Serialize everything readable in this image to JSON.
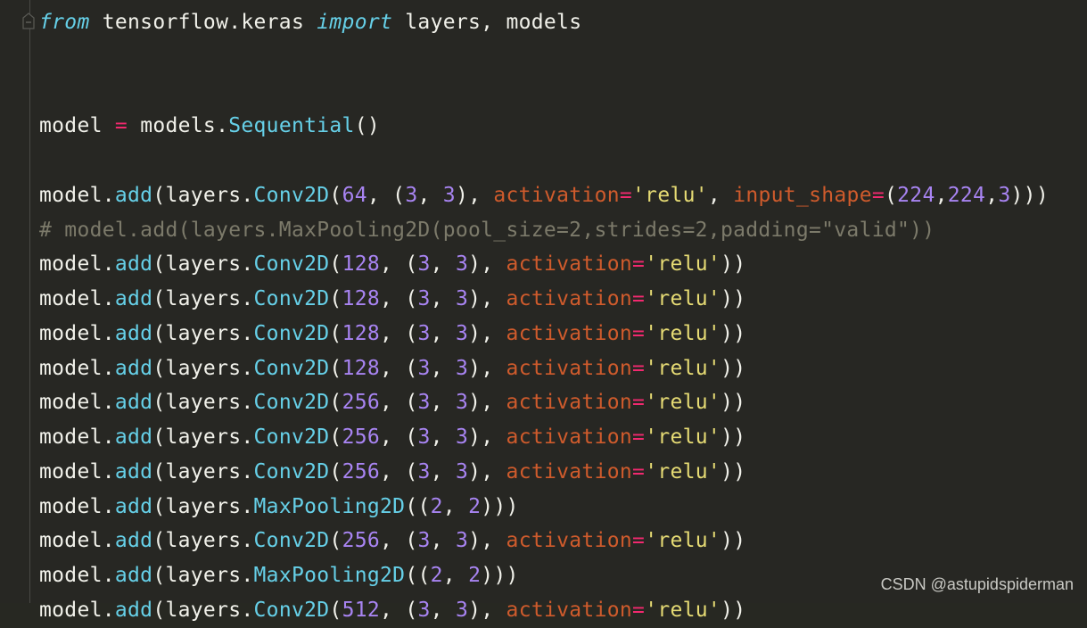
{
  "editor": {
    "lines": [
      [
        {
          "t": "kw",
          "v": "from"
        },
        {
          "t": "txt",
          "v": " tensorflow.keras "
        },
        {
          "t": "kw",
          "v": "import"
        },
        {
          "t": "txt",
          "v": " layers, models"
        }
      ],
      [],
      [],
      [
        {
          "t": "txt",
          "v": "model "
        },
        {
          "t": "op",
          "v": "="
        },
        {
          "t": "txt",
          "v": " models."
        },
        {
          "t": "fn",
          "v": "Sequential"
        },
        {
          "t": "txt",
          "v": "()"
        }
      ],
      [],
      [
        {
          "t": "txt",
          "v": "model."
        },
        {
          "t": "fn",
          "v": "add"
        },
        {
          "t": "txt",
          "v": "(layers."
        },
        {
          "t": "fn",
          "v": "Conv2D"
        },
        {
          "t": "txt",
          "v": "("
        },
        {
          "t": "num",
          "v": "64"
        },
        {
          "t": "txt",
          "v": ", ("
        },
        {
          "t": "num",
          "v": "3"
        },
        {
          "t": "txt",
          "v": ", "
        },
        {
          "t": "num",
          "v": "3"
        },
        {
          "t": "txt",
          "v": "), "
        },
        {
          "t": "param",
          "v": "activation"
        },
        {
          "t": "op",
          "v": "="
        },
        {
          "t": "str",
          "v": "'relu'"
        },
        {
          "t": "txt",
          "v": ", "
        },
        {
          "t": "param",
          "v": "input_shape"
        },
        {
          "t": "op",
          "v": "="
        },
        {
          "t": "txt",
          "v": "("
        },
        {
          "t": "num",
          "v": "224"
        },
        {
          "t": "txt",
          "v": ","
        },
        {
          "t": "num",
          "v": "224"
        },
        {
          "t": "txt",
          "v": ","
        },
        {
          "t": "num",
          "v": "3"
        },
        {
          "t": "txt",
          "v": ")))"
        }
      ],
      [
        {
          "t": "cm",
          "v": "# model.add(layers.MaxPooling2D(pool_size=2,strides=2,padding=\"valid\"))"
        }
      ],
      [
        {
          "t": "txt",
          "v": "model."
        },
        {
          "t": "fn",
          "v": "add"
        },
        {
          "t": "txt",
          "v": "(layers."
        },
        {
          "t": "fn",
          "v": "Conv2D"
        },
        {
          "t": "txt",
          "v": "("
        },
        {
          "t": "num",
          "v": "128"
        },
        {
          "t": "txt",
          "v": ", ("
        },
        {
          "t": "num",
          "v": "3"
        },
        {
          "t": "txt",
          "v": ", "
        },
        {
          "t": "num",
          "v": "3"
        },
        {
          "t": "txt",
          "v": "), "
        },
        {
          "t": "param",
          "v": "activation"
        },
        {
          "t": "op",
          "v": "="
        },
        {
          "t": "str",
          "v": "'relu'"
        },
        {
          "t": "txt",
          "v": "))"
        }
      ],
      [
        {
          "t": "txt",
          "v": "model."
        },
        {
          "t": "fn",
          "v": "add"
        },
        {
          "t": "txt",
          "v": "(layers."
        },
        {
          "t": "fn",
          "v": "Conv2D"
        },
        {
          "t": "txt",
          "v": "("
        },
        {
          "t": "num",
          "v": "128"
        },
        {
          "t": "txt",
          "v": ", ("
        },
        {
          "t": "num",
          "v": "3"
        },
        {
          "t": "txt",
          "v": ", "
        },
        {
          "t": "num",
          "v": "3"
        },
        {
          "t": "txt",
          "v": "), "
        },
        {
          "t": "param",
          "v": "activation"
        },
        {
          "t": "op",
          "v": "="
        },
        {
          "t": "str",
          "v": "'relu'"
        },
        {
          "t": "txt",
          "v": "))"
        }
      ],
      [
        {
          "t": "txt",
          "v": "model."
        },
        {
          "t": "fn",
          "v": "add"
        },
        {
          "t": "txt",
          "v": "(layers."
        },
        {
          "t": "fn",
          "v": "Conv2D"
        },
        {
          "t": "txt",
          "v": "("
        },
        {
          "t": "num",
          "v": "128"
        },
        {
          "t": "txt",
          "v": ", ("
        },
        {
          "t": "num",
          "v": "3"
        },
        {
          "t": "txt",
          "v": ", "
        },
        {
          "t": "num",
          "v": "3"
        },
        {
          "t": "txt",
          "v": "), "
        },
        {
          "t": "param",
          "v": "activation"
        },
        {
          "t": "op",
          "v": "="
        },
        {
          "t": "str",
          "v": "'relu'"
        },
        {
          "t": "txt",
          "v": "))"
        }
      ],
      [
        {
          "t": "txt",
          "v": "model."
        },
        {
          "t": "fn",
          "v": "add"
        },
        {
          "t": "txt",
          "v": "(layers."
        },
        {
          "t": "fn",
          "v": "Conv2D"
        },
        {
          "t": "txt",
          "v": "("
        },
        {
          "t": "num",
          "v": "128"
        },
        {
          "t": "txt",
          "v": ", ("
        },
        {
          "t": "num",
          "v": "3"
        },
        {
          "t": "txt",
          "v": ", "
        },
        {
          "t": "num",
          "v": "3"
        },
        {
          "t": "txt",
          "v": "), "
        },
        {
          "t": "param",
          "v": "activation"
        },
        {
          "t": "op",
          "v": "="
        },
        {
          "t": "str",
          "v": "'relu'"
        },
        {
          "t": "txt",
          "v": "))"
        }
      ],
      [
        {
          "t": "txt",
          "v": "model."
        },
        {
          "t": "fn",
          "v": "add"
        },
        {
          "t": "txt",
          "v": "(layers."
        },
        {
          "t": "fn",
          "v": "Conv2D"
        },
        {
          "t": "txt",
          "v": "("
        },
        {
          "t": "num",
          "v": "256"
        },
        {
          "t": "txt",
          "v": ", ("
        },
        {
          "t": "num",
          "v": "3"
        },
        {
          "t": "txt",
          "v": ", "
        },
        {
          "t": "num",
          "v": "3"
        },
        {
          "t": "txt",
          "v": "), "
        },
        {
          "t": "param",
          "v": "activation"
        },
        {
          "t": "op",
          "v": "="
        },
        {
          "t": "str",
          "v": "'relu'"
        },
        {
          "t": "txt",
          "v": "))"
        }
      ],
      [
        {
          "t": "txt",
          "v": "model."
        },
        {
          "t": "fn",
          "v": "add"
        },
        {
          "t": "txt",
          "v": "(layers."
        },
        {
          "t": "fn",
          "v": "Conv2D"
        },
        {
          "t": "txt",
          "v": "("
        },
        {
          "t": "num",
          "v": "256"
        },
        {
          "t": "txt",
          "v": ", ("
        },
        {
          "t": "num",
          "v": "3"
        },
        {
          "t": "txt",
          "v": ", "
        },
        {
          "t": "num",
          "v": "3"
        },
        {
          "t": "txt",
          "v": "), "
        },
        {
          "t": "param",
          "v": "activation"
        },
        {
          "t": "op",
          "v": "="
        },
        {
          "t": "str",
          "v": "'relu'"
        },
        {
          "t": "txt",
          "v": "))"
        }
      ],
      [
        {
          "t": "txt",
          "v": "model."
        },
        {
          "t": "fn",
          "v": "add"
        },
        {
          "t": "txt",
          "v": "(layers."
        },
        {
          "t": "fn",
          "v": "Conv2D"
        },
        {
          "t": "txt",
          "v": "("
        },
        {
          "t": "num",
          "v": "256"
        },
        {
          "t": "txt",
          "v": ", ("
        },
        {
          "t": "num",
          "v": "3"
        },
        {
          "t": "txt",
          "v": ", "
        },
        {
          "t": "num",
          "v": "3"
        },
        {
          "t": "txt",
          "v": "), "
        },
        {
          "t": "param",
          "v": "activation"
        },
        {
          "t": "op",
          "v": "="
        },
        {
          "t": "str",
          "v": "'relu'"
        },
        {
          "t": "txt",
          "v": "))"
        }
      ],
      [
        {
          "t": "txt",
          "v": "model."
        },
        {
          "t": "fn",
          "v": "add"
        },
        {
          "t": "txt",
          "v": "(layers."
        },
        {
          "t": "fn",
          "v": "MaxPooling2D"
        },
        {
          "t": "txt",
          "v": "(("
        },
        {
          "t": "num",
          "v": "2"
        },
        {
          "t": "txt",
          "v": ", "
        },
        {
          "t": "num",
          "v": "2"
        },
        {
          "t": "txt",
          "v": ")))"
        }
      ],
      [
        {
          "t": "txt",
          "v": "model."
        },
        {
          "t": "fn",
          "v": "add"
        },
        {
          "t": "txt",
          "v": "(layers."
        },
        {
          "t": "fn",
          "v": "Conv2D"
        },
        {
          "t": "txt",
          "v": "("
        },
        {
          "t": "num",
          "v": "256"
        },
        {
          "t": "txt",
          "v": ", ("
        },
        {
          "t": "num",
          "v": "3"
        },
        {
          "t": "txt",
          "v": ", "
        },
        {
          "t": "num",
          "v": "3"
        },
        {
          "t": "txt",
          "v": "), "
        },
        {
          "t": "param",
          "v": "activation"
        },
        {
          "t": "op",
          "v": "="
        },
        {
          "t": "str",
          "v": "'relu'"
        },
        {
          "t": "txt",
          "v": "))"
        }
      ],
      [
        {
          "t": "txt",
          "v": "model."
        },
        {
          "t": "fn",
          "v": "add"
        },
        {
          "t": "txt",
          "v": "(layers."
        },
        {
          "t": "fn",
          "v": "MaxPooling2D"
        },
        {
          "t": "txt",
          "v": "(("
        },
        {
          "t": "num",
          "v": "2"
        },
        {
          "t": "txt",
          "v": ", "
        },
        {
          "t": "num",
          "v": "2"
        },
        {
          "t": "txt",
          "v": ")))"
        }
      ],
      [
        {
          "t": "txt",
          "v": "model."
        },
        {
          "t": "fn",
          "v": "add"
        },
        {
          "t": "txt",
          "v": "(layers."
        },
        {
          "t": "fn",
          "v": "Conv2D"
        },
        {
          "t": "txt",
          "v": "("
        },
        {
          "t": "num",
          "v": "512"
        },
        {
          "t": "txt",
          "v": ", ("
        },
        {
          "t": "num",
          "v": "3"
        },
        {
          "t": "txt",
          "v": ", "
        },
        {
          "t": "num",
          "v": "3"
        },
        {
          "t": "txt",
          "v": "), "
        },
        {
          "t": "param",
          "v": "activation"
        },
        {
          "t": "op",
          "v": "="
        },
        {
          "t": "str",
          "v": "'relu'"
        },
        {
          "t": "txt",
          "v": "))"
        }
      ]
    ]
  },
  "watermark": "CSDN @astupidspiderman",
  "colors": {
    "background": "#272723",
    "keyword": "#66d0e8",
    "number": "#a884f2",
    "operator": "#f2296f",
    "parameter": "#cf5b2c",
    "string": "#e6db74",
    "comment": "#7c7a6a",
    "text": "#f1f1ea"
  }
}
